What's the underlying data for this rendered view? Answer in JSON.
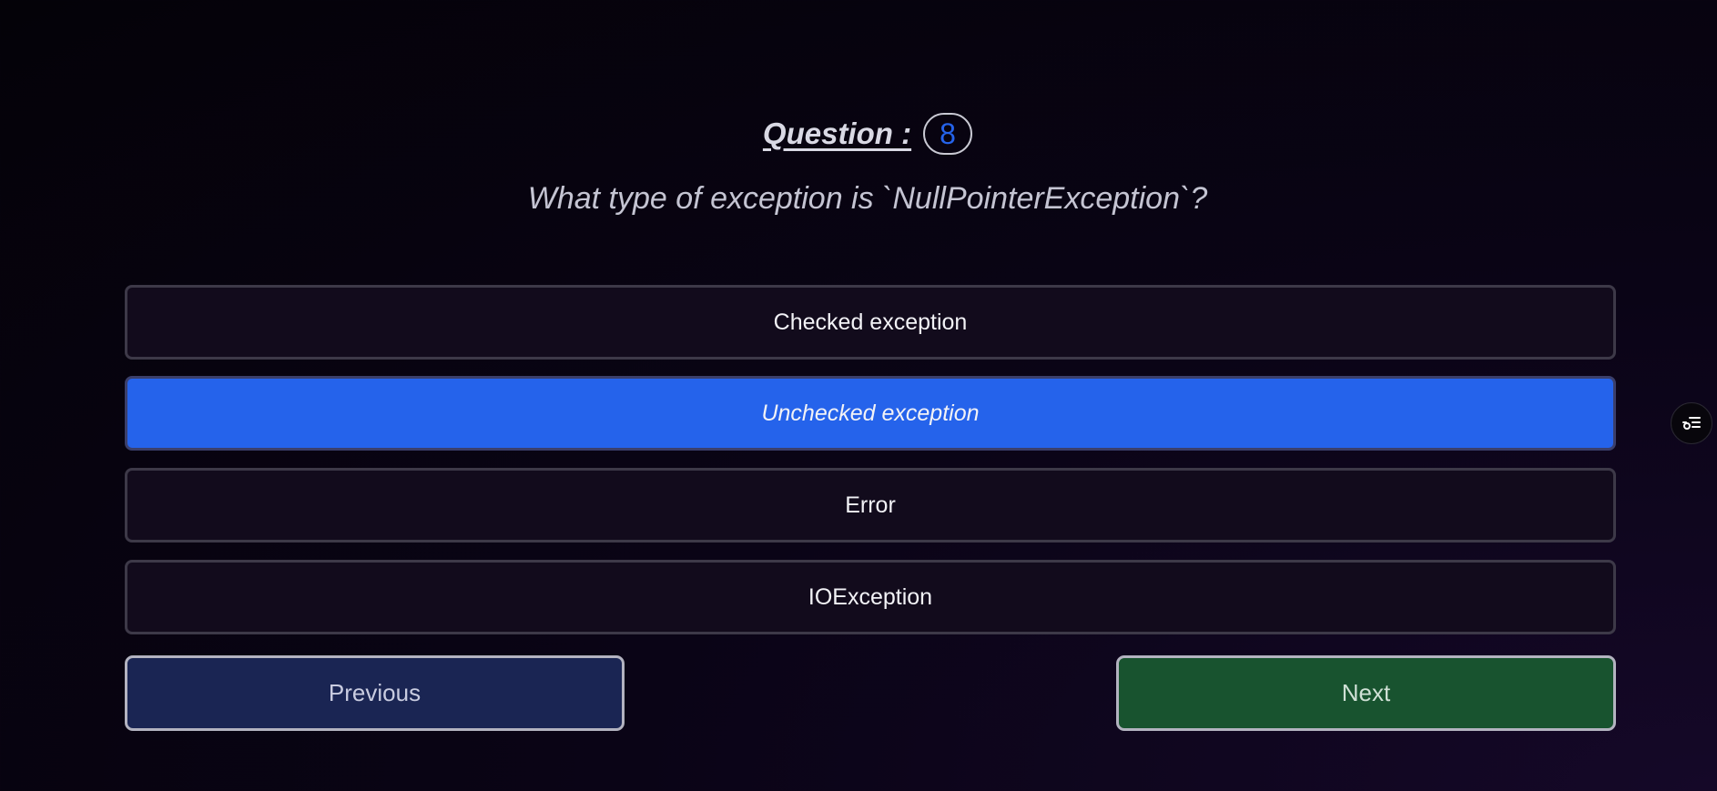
{
  "question": {
    "label": "Question :",
    "number": "8",
    "text": "What type of exception is `NullPointerException`?"
  },
  "options": [
    {
      "label": "Checked exception",
      "selected": false
    },
    {
      "label": "Unchecked exception",
      "selected": true
    },
    {
      "label": "Error",
      "selected": false
    },
    {
      "label": "IOException",
      "selected": false
    }
  ],
  "navigation": {
    "previous_label": "Previous",
    "next_label": "Next"
  },
  "side_button": {
    "icon": "list-settings-icon"
  },
  "colors": {
    "accent": "#2563eb",
    "previous_bg": "#1a2553",
    "next_bg": "#18532f",
    "option_bg": "#120b1c"
  }
}
